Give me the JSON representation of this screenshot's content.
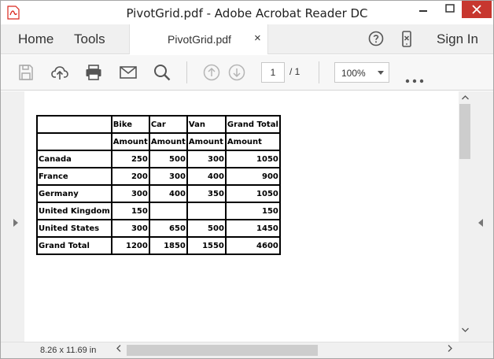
{
  "window": {
    "title": "PivotGrid.pdf - Adobe Acrobat Reader DC"
  },
  "menu": {
    "home": "Home",
    "tools": "Tools",
    "doc_tab": "PivotGrid.pdf",
    "close_tab": "×",
    "sign_in": "Sign In"
  },
  "toolbar": {
    "page_current": "1",
    "page_total": "/ 1",
    "zoom": "100%",
    "more": "•••"
  },
  "pivot": {
    "header_row1": [
      "",
      "Bike",
      "Car",
      "Van",
      "Grand Total"
    ],
    "header_row2": [
      "",
      "Amount",
      "Amount",
      "Amount",
      "Amount"
    ],
    "rows": [
      [
        "Canada",
        "250",
        "500",
        "300",
        "1050"
      ],
      [
        "France",
        "200",
        "300",
        "400",
        "900"
      ],
      [
        "Germany",
        "300",
        "400",
        "350",
        "1050"
      ],
      [
        "United Kingdom",
        "150",
        "",
        "",
        "150"
      ],
      [
        "United States",
        "300",
        "650",
        "500",
        "1450"
      ],
      [
        "Grand Total",
        "1200",
        "1850",
        "1550",
        "4600"
      ]
    ]
  },
  "status": {
    "page_size": "8.26 x 11.69 in"
  },
  "colors": {
    "close_button": "#c7372f",
    "pdf_red": "#d9261c",
    "icon_gray": "#555555"
  }
}
